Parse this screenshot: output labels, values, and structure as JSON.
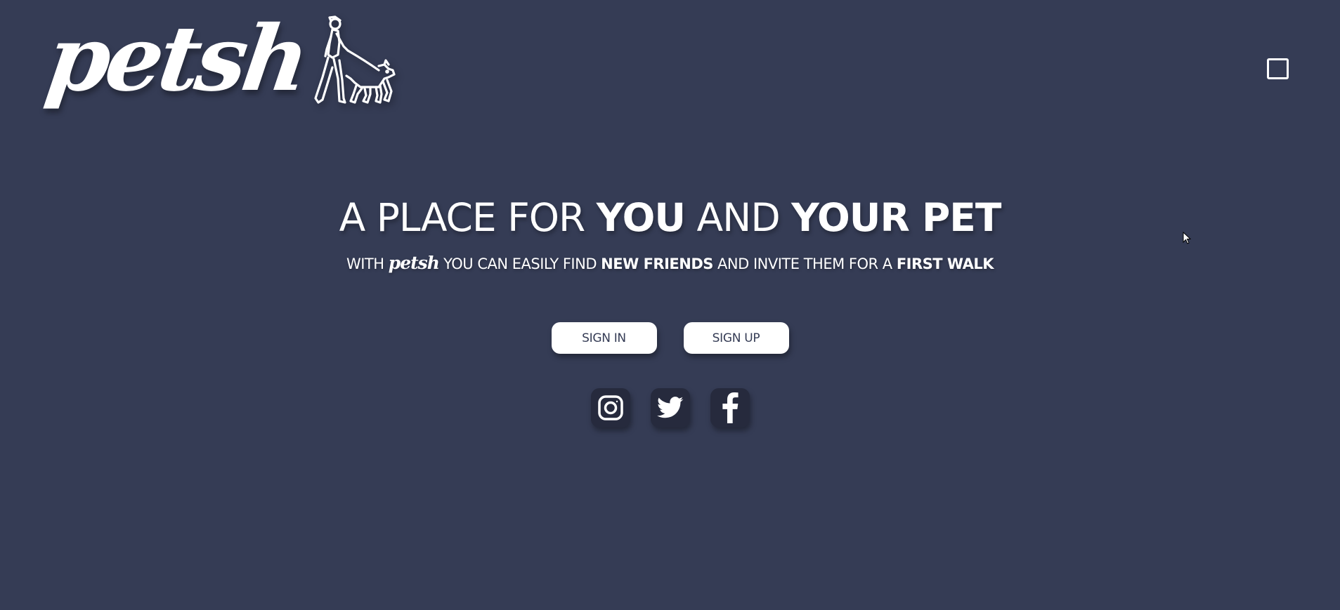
{
  "header": {
    "logo_text": "petsh",
    "logo_figure_icon": "person-walking-dog-icon",
    "menu_icon": "menu-toggle-icon"
  },
  "hero": {
    "headline": {
      "part1": "A PLACE FOR ",
      "part2": "YOU",
      "part3": " AND ",
      "part4": "YOUR PET"
    },
    "tagline": {
      "part1": "WITH ",
      "brand": "petsh",
      "part2": " YOU CAN EASILY FIND ",
      "part3": "NEW FRIENDS",
      "part4": " AND INVITE THEM FOR A ",
      "part5": "FIRST WALK"
    }
  },
  "auth": {
    "signin_label": "SIGN IN",
    "signup_label": "SIGN UP"
  },
  "social": {
    "items": [
      {
        "icon": "instagram-icon"
      },
      {
        "icon": "twitter-icon"
      },
      {
        "icon": "facebook-icon"
      }
    ]
  },
  "colors": {
    "background": "#353c55",
    "button_bg": "#ffffff",
    "button_text": "#353c55",
    "social_bg": "#262a3d",
    "text": "#ffffff"
  }
}
